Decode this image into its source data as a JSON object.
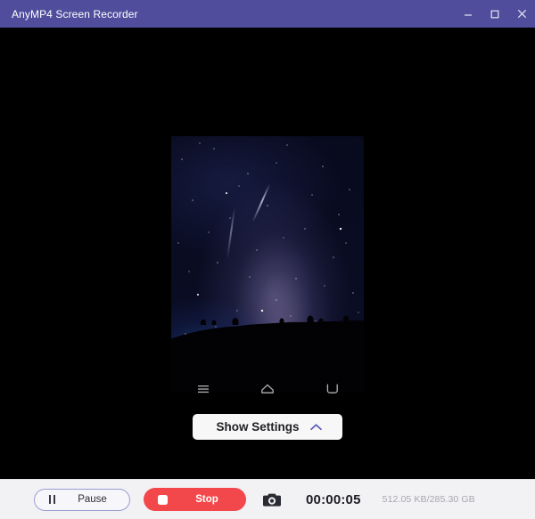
{
  "window": {
    "title": "AnyMP4 Screen Recorder",
    "accent_color": "#504e9c",
    "controls": {
      "minimize": "minimize-button",
      "maximize": "maximize-button",
      "close": "close-button"
    }
  },
  "stage": {
    "background_color": "#000000",
    "preview": {
      "kind": "phone-screen-mirror",
      "content_description": "Night sky Milky Way photograph over a dark hill silhouette"
    },
    "android_nav": [
      {
        "name": "menu-icon",
        "label": "Menu"
      },
      {
        "name": "home-icon",
        "label": "Home"
      },
      {
        "name": "back-icon",
        "label": "Back"
      }
    ],
    "show_settings": {
      "label": "Show Settings",
      "chevron": "chevron-up-icon",
      "chevron_color": "#5a5ab8"
    }
  },
  "controlbar": {
    "background_color": "#f2f2f5",
    "pause": {
      "label": "Pause",
      "icon": "pause-icon",
      "border_color": "#9b9bd0"
    },
    "stop": {
      "label": "Stop",
      "icon": "stop-square-icon",
      "color": "#f2484b"
    },
    "snapshot": {
      "icon": "camera-icon",
      "label": "Snapshot"
    },
    "timer": "00:00:05",
    "storage": "512.05 KB/285.30 GB"
  }
}
